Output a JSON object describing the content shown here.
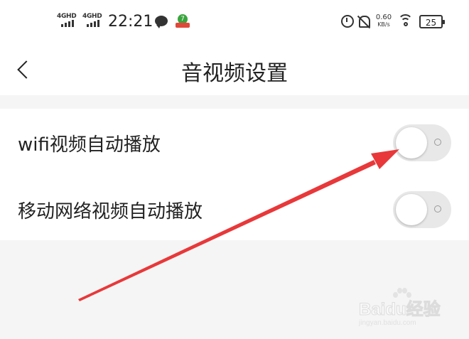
{
  "status_bar": {
    "network_1": "4GHD",
    "network_2": "4GHD",
    "time": "22:21",
    "app_badge_digit": "7",
    "speed_value": "0.60",
    "speed_unit": "KB/s",
    "battery": "25"
  },
  "nav": {
    "title": "音视频设置"
  },
  "settings": [
    {
      "label": "wifi视频自动播放",
      "enabled": false
    },
    {
      "label": "移动网络视频自动播放",
      "enabled": false
    }
  ],
  "annotation": {
    "arrow_color": "#e8383a"
  },
  "watermark": {
    "brand": "Baidu经验",
    "url": "jingyan.baidu.com"
  },
  "colors": {
    "background": "#f5f5f5",
    "surface": "#ffffff",
    "toggle_off": "#e8e8e8"
  }
}
